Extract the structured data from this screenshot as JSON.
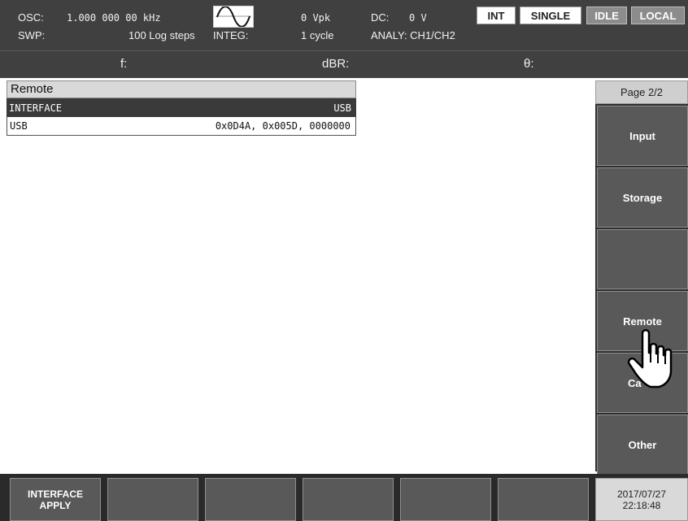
{
  "status": {
    "osc_label": "OSC:",
    "osc_freq": "1.000 000 00 kHz",
    "waveform_icon": "sine-wave-icon",
    "amplitude": "0 Vpk",
    "dc_label": "DC:",
    "dc_value": "0 V",
    "swp_label": "SWP:",
    "swp_value": "100 Log steps",
    "integ_label": "INTEG:",
    "integ_value": "1 cycle",
    "analy": "ANALY: CH1/CH2",
    "f_label": "f:",
    "dbr_label": "dBR:",
    "theta_label": "θ:",
    "badges": [
      "INT",
      "SINGLE",
      "IDLE",
      "LOCAL"
    ]
  },
  "remote_panel": {
    "title": "Remote",
    "rows": [
      {
        "key": "INTERFACE",
        "value": "USB"
      },
      {
        "key": "USB",
        "value": "0x0D4A, 0x005D, 0000000"
      }
    ]
  },
  "side_menu": {
    "page": "Page 2/2",
    "buttons": [
      "Input",
      "Storage",
      "",
      "Remote",
      "Ca",
      "Other"
    ]
  },
  "bottom_bar": {
    "interface_apply_line1": "INTERFACE",
    "interface_apply_line2": "APPLY",
    "date": "2017/07/27",
    "time": "22:18:48"
  },
  "colors": {
    "status_bg": "#404040",
    "button_bg": "#595959",
    "selected_row_bg": "#3a3a3a"
  }
}
